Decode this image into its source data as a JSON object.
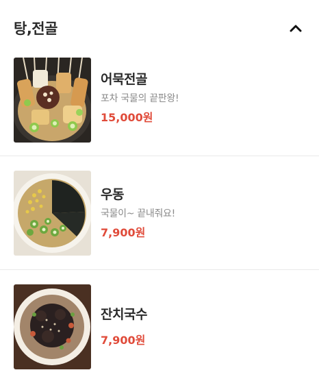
{
  "section": {
    "title": "탕,전골",
    "toggle_icon": "chevron-up-icon"
  },
  "items": [
    {
      "name": "어묵전골",
      "description": "포차 국물의 끝판왕!",
      "price": "15,000원",
      "image": "fishcake-hotpot-photo"
    },
    {
      "name": "우동",
      "description": "국물이~ 끝내줘요!",
      "price": "7,900원",
      "image": "udon-photo"
    },
    {
      "name": "잔치국수",
      "description": "",
      "price": "7,900원",
      "image": "janchi-noodle-photo"
    }
  ],
  "colors": {
    "price": "#e04b3a",
    "divider": "#e9e9e9"
  }
}
